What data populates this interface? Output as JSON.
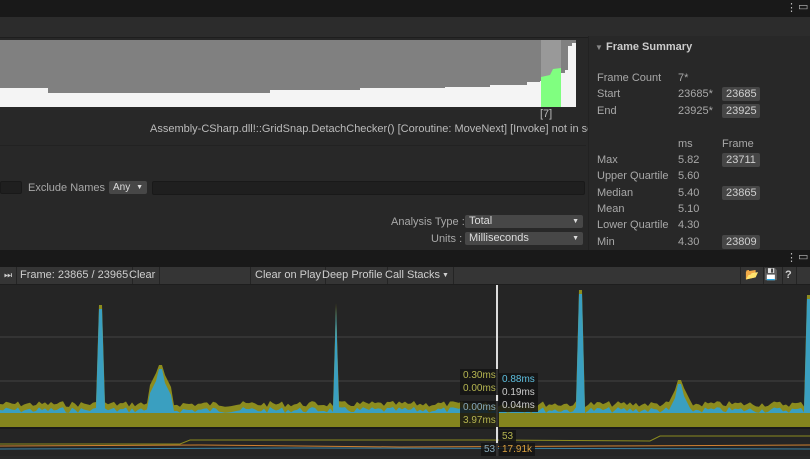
{
  "histogram": {
    "selected_label": "[7]",
    "marker_text": "Assembly-CSharp.dll!::GridSnap.DetachChecker() [Coroutine: MoveNext] [Invoke] not in selection"
  },
  "filters": {
    "exclude_label": "Exclude Names :",
    "exclude_mode": "Any",
    "exclude_value": "",
    "analysis_label": "Analysis Type :",
    "analysis_value": "Total",
    "units_label": "Units :",
    "units_value": "Milliseconds"
  },
  "summary": {
    "title": "Frame Summary",
    "frame_count_label": "Frame Count",
    "frame_count": "7*",
    "start_label": "Start",
    "start": "23685*",
    "start_btn": "23685",
    "end_label": "End",
    "end": "23925*",
    "end_btn": "23925",
    "col_ms": "ms",
    "col_frame": "Frame",
    "rows": [
      {
        "label": "Max",
        "ms": "5.82",
        "frame": "23711"
      },
      {
        "label": "Upper Quartile",
        "ms": "5.60",
        "frame": null
      },
      {
        "label": "Median",
        "ms": "5.40",
        "frame": "23865"
      },
      {
        "label": "Mean",
        "ms": "5.10",
        "frame": null
      },
      {
        "label": "Lower Quartile",
        "ms": "4.30",
        "frame": null
      },
      {
        "label": "Min",
        "ms": "4.30",
        "frame": "23809"
      }
    ]
  },
  "profiler": {
    "frame": "Frame: 23865 / 23965",
    "clear": "Clear",
    "clear_on_play": "Clear on Play",
    "deep_profile": "Deep Profile",
    "call_stacks": "Call Stacks",
    "tooltips_left": [
      "0.30ms",
      "0.00ms",
      "0.00ms",
      "3.97ms"
    ],
    "tooltips_right": [
      "0.88ms",
      "0.19ms",
      "0.04ms"
    ],
    "mem_left": "53",
    "mem_right": [
      "53",
      "17.91k"
    ]
  },
  "colors": {
    "olive": "#8c8c1e",
    "blue": "#3a9fc0",
    "green": "#80ff80"
  }
}
